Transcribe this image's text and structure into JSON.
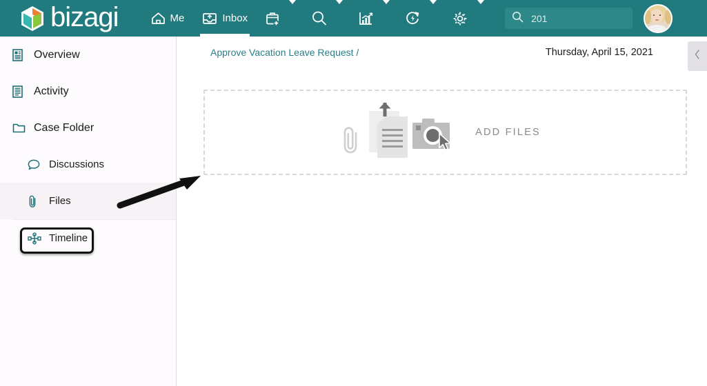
{
  "brand": {
    "name": "bizagi",
    "logo_icon": "hexagon-logo-icon"
  },
  "topnav": {
    "items": [
      {
        "label": "Me",
        "icon": "home-icon",
        "active": false
      },
      {
        "label": "Inbox",
        "icon": "inbox-tray-icon",
        "active": true
      }
    ],
    "icon_buttons": [
      {
        "icon": "new-case-briefcase-icon",
        "has_caret": true
      },
      {
        "icon": "search-icon",
        "has_caret": true
      },
      {
        "icon": "analytics-chart-icon",
        "has_caret": true
      },
      {
        "icon": "process-refresh-icon",
        "has_caret": true
      },
      {
        "icon": "gear-icon",
        "has_caret": true
      }
    ],
    "search": {
      "icon": "search-icon",
      "value": "201",
      "placeholder": "Search"
    },
    "avatar": {
      "icon": "user-avatar"
    }
  },
  "sidebar": {
    "items": [
      {
        "label": "Overview",
        "icon": "document-list-icon",
        "sub": false,
        "highlight": false
      },
      {
        "label": "Activity",
        "icon": "document-list-icon",
        "sub": false,
        "highlight": false
      },
      {
        "label": "Case Folder",
        "icon": "folder-icon",
        "sub": false,
        "highlight": false
      },
      {
        "label": "Discussions",
        "icon": "speech-bubble-icon",
        "sub": true,
        "highlight": false
      },
      {
        "label": "Files",
        "icon": "paperclip-icon",
        "sub": true,
        "highlight": true
      },
      {
        "label": "Timeline",
        "icon": "timeline-node-icon",
        "sub": true,
        "highlight": false
      }
    ]
  },
  "main": {
    "breadcrumb": "Approve Vacation Leave Request /",
    "date": "Thursday, April 15, 2021",
    "collapse_icon": "chevron-left-icon",
    "dropzone": {
      "label": "ADD FILES",
      "icons": [
        "paperclip-icon",
        "document-upload-icon",
        "camera-icon",
        "cursor-pointer-icon"
      ]
    }
  },
  "annotations": {
    "arrow": "pointer-arrow-to-files",
    "highlight_box": "files-highlight-box"
  },
  "colors": {
    "brand_teal": "#217b7e",
    "link_teal": "#2a7f86",
    "sidebar_bg": "#fdfbfd",
    "highlight_row": "#f6f2f6",
    "dropzone_border": "#d8d8da",
    "annotation_black": "#121212"
  }
}
